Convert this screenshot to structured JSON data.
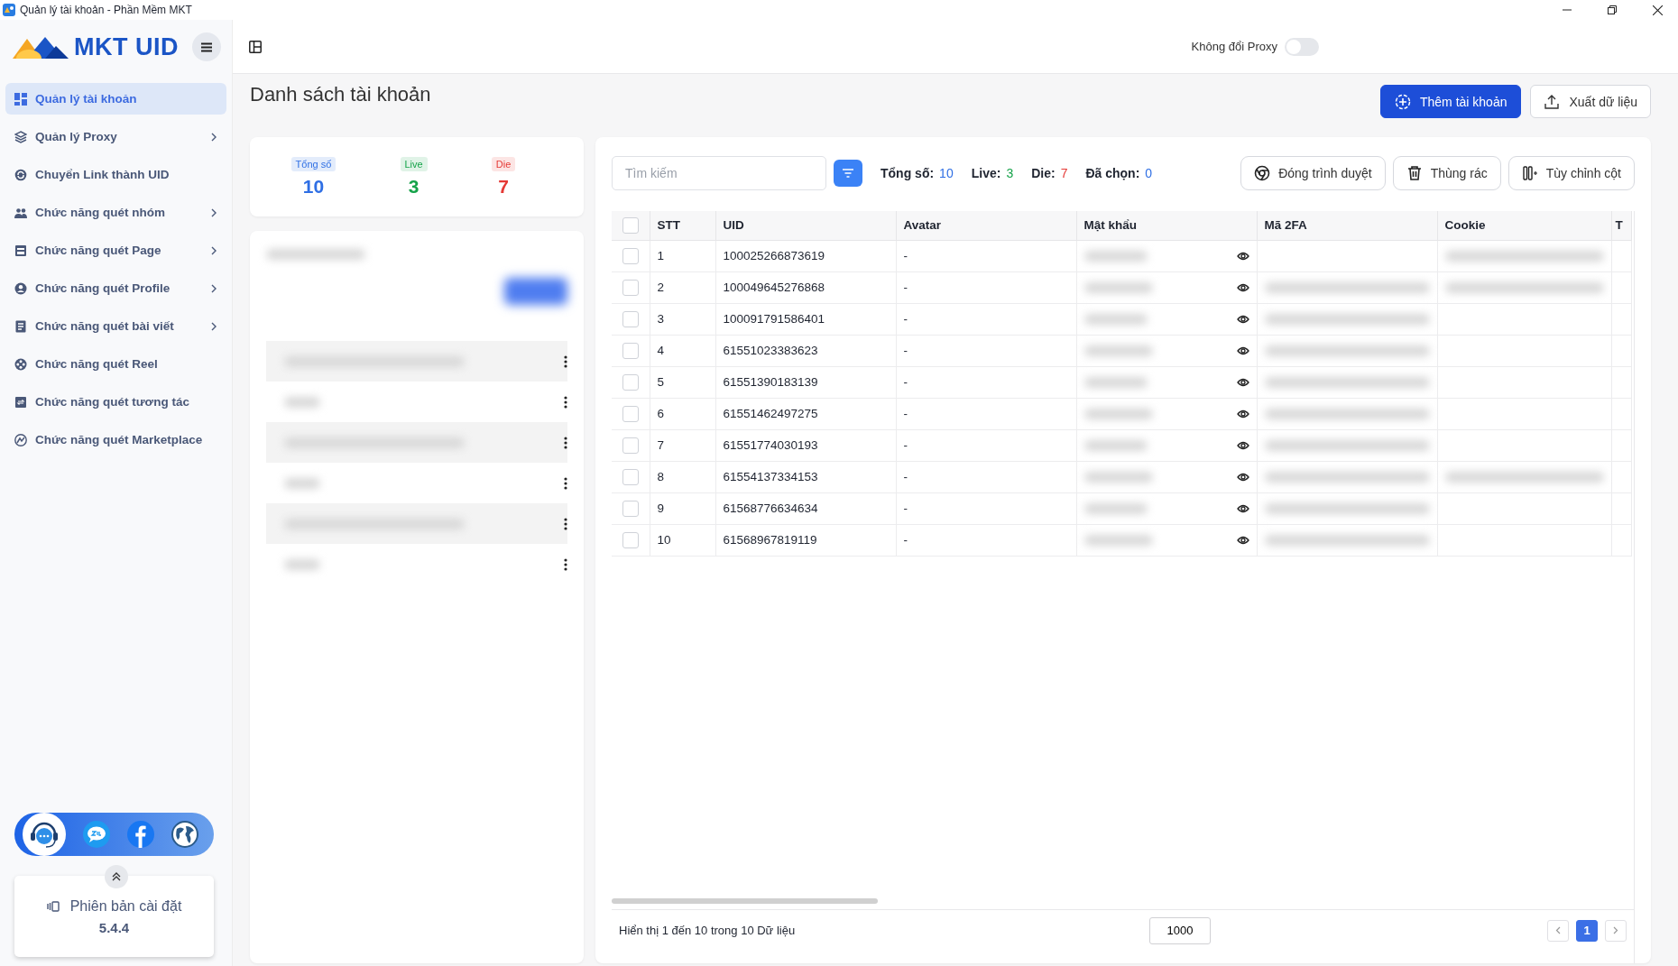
{
  "window": {
    "title": "Quản lý tài khoản - Phần Mềm MKT"
  },
  "logo": {
    "text": "MKT UID"
  },
  "sidebar": {
    "items": [
      {
        "label": "Quản lý tài khoản",
        "selected": true,
        "has_submenu": false
      },
      {
        "label": "Quản lý Proxy",
        "selected": false,
        "has_submenu": true
      },
      {
        "label": "Chuyển Link thành UID",
        "selected": false,
        "has_submenu": false
      },
      {
        "label": "Chức năng quét nhóm",
        "selected": false,
        "has_submenu": true
      },
      {
        "label": "Chức năng quét Page",
        "selected": false,
        "has_submenu": true
      },
      {
        "label": "Chức năng quét Profile",
        "selected": false,
        "has_submenu": true
      },
      {
        "label": "Chức năng quét bài viết",
        "selected": false,
        "has_submenu": true
      },
      {
        "label": "Chức năng quét Reel",
        "selected": false,
        "has_submenu": false
      },
      {
        "label": "Chức năng quét tương tác",
        "selected": false,
        "has_submenu": false
      },
      {
        "label": "Chức năng quét Marketplace",
        "selected": false,
        "has_submenu": false
      }
    ],
    "version": {
      "label": "Phiên bản cài đặt",
      "value": "5.4.4"
    }
  },
  "header": {
    "proxy_toggle": {
      "label": "Không đổi Proxy",
      "on": false
    }
  },
  "page": {
    "title": "Danh sách tài khoản",
    "buttons": [
      {
        "label": "Thêm tài khoản",
        "kind": "primary"
      },
      {
        "label": "Xuất dữ liệu",
        "kind": "export"
      }
    ]
  },
  "summary": [
    {
      "label": "Tổng số",
      "value": "10",
      "color": "#2f6fe4"
    },
    {
      "label": "Live",
      "value": "3",
      "color": "#16a34a"
    },
    {
      "label": "Die",
      "value": "7",
      "color": "#e53935"
    }
  ],
  "toolbar": {
    "search": {
      "placeholder": "Tìm kiếm"
    },
    "stats": [
      {
        "label": "Tổng số:",
        "value": "10",
        "color": "#2f6fe4"
      },
      {
        "label": "Live:",
        "value": "3",
        "color": "#16a34a"
      },
      {
        "label": "Die:",
        "value": "7",
        "color": "#e53935"
      },
      {
        "label": "Đã chọn:",
        "value": "0",
        "color": "#2f6fe4"
      }
    ],
    "buttons": [
      {
        "label": "Đóng trình duyệt",
        "kind": "browser"
      },
      {
        "label": "Thùng rác",
        "kind": "trash"
      },
      {
        "label": "Tùy chỉnh cột",
        "kind": "columns"
      }
    ]
  },
  "table": {
    "columns": [
      "STT",
      "UID",
      "Avatar",
      "Mật khẩu",
      "Mã 2FA",
      "Cookie",
      "T"
    ],
    "all_checked": false,
    "rows": [
      {
        "checked": false,
        "stt": "1",
        "uid": "100025266873619",
        "avatar": "-",
        "has_2fa": false,
        "has_cookie": true
      },
      {
        "checked": false,
        "stt": "2",
        "uid": "100049645276868",
        "avatar": "-",
        "has_2fa": true,
        "has_cookie": true
      },
      {
        "checked": false,
        "stt": "3",
        "uid": "100091791586401",
        "avatar": "-",
        "has_2fa": true,
        "has_cookie": false
      },
      {
        "checked": false,
        "stt": "4",
        "uid": "61551023383623",
        "avatar": "-",
        "has_2fa": true,
        "has_cookie": false
      },
      {
        "checked": false,
        "stt": "5",
        "uid": "61551390183139",
        "avatar": "-",
        "has_2fa": true,
        "has_cookie": false
      },
      {
        "checked": false,
        "stt": "6",
        "uid": "61551462497275",
        "avatar": "-",
        "has_2fa": true,
        "has_cookie": false
      },
      {
        "checked": false,
        "stt": "7",
        "uid": "61551774030193",
        "avatar": "-",
        "has_2fa": true,
        "has_cookie": false
      },
      {
        "checked": false,
        "stt": "8",
        "uid": "61554137334153",
        "avatar": "-",
        "has_2fa": true,
        "has_cookie": true
      },
      {
        "checked": false,
        "stt": "9",
        "uid": "61568776634634",
        "avatar": "-",
        "has_2fa": true,
        "has_cookie": false
      },
      {
        "checked": false,
        "stt": "10",
        "uid": "61568967819119",
        "avatar": "-",
        "has_2fa": true,
        "has_cookie": false
      }
    ]
  },
  "footer": {
    "info": "Hiển thị 1 đến 10 trong 10 Dữ liệu",
    "page_size": "1000",
    "pages": [
      {
        "label": "1",
        "selected": true
      }
    ]
  }
}
